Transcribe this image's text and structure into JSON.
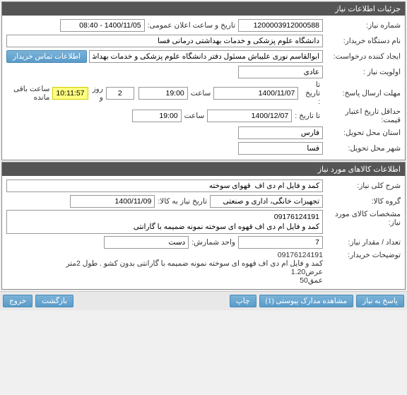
{
  "panel1": {
    "title": "جزئیات اطلاعات نیاز",
    "rows": {
      "need_no_label": "شماره نیاز:",
      "need_no": "1200003912000588",
      "announce_label": "تاریخ و ساعت اعلان عمومی:",
      "announce": "1400/11/05 - 08:40",
      "buyer_label": "نام دستگاه خریدار:",
      "buyer": "دانشگاه علوم پزشکی و خدمات بهداشتی درمانی فسا",
      "creator_label": "ایجاد کننده درخواست:",
      "creator": "ابوالقاسم نوری علیباش مسئول دفتر دانشگاه علوم پزشکی و خدمات بهداشتی د",
      "contact_btn": "اطلاعات تماس خریدار",
      "priority_label": "اولویت نیاز :",
      "priority": "عادی",
      "reply_deadline_label": "مهلت ارسال پاسخ:",
      "to_date1_label": "تا تاریخ :",
      "to_date1": "1400/11/07",
      "time1_label": "ساعت",
      "time1": "19:00",
      "days": "2",
      "days_label": "روز و",
      "remaining_time": "10:11:57",
      "remaining_label": "ساعت باقی مانده",
      "price_validity_label": "حداقل تاریخ اعتبار قیمت:",
      "to_date2_label": "تا تاریخ :",
      "to_date2": "1400/12/07",
      "time2_label": "ساعت",
      "time2": "19:00",
      "province_label": "استان محل تحویل:",
      "province": "فارس",
      "city_label": "شهر محل تحویل:",
      "city": "فسا"
    }
  },
  "panel2": {
    "title": "اطلاعات کالاهای مورد نیاز",
    "rows": {
      "desc_label": "شرح کلی نیاز:",
      "desc": "کمد و فایل ام دی اف  قهوای سوخته",
      "group_label": "گروه کالا:",
      "group": "تجهیزات خانگی، اداری و صنعتی",
      "need_date_label": "تاریخ نیاز به کالا:",
      "need_date": "1400/11/09",
      "spec_label": "مشخصات کالای مورد نیاز:",
      "spec_line1": "09176124191",
      "spec_line2": "کمد و فایل ام دی اف قهوه ای سوخته نمونه ضمیمه با گارانتی",
      "qty_label": "تعداد / مقدار نیاز:",
      "qty": "7",
      "unit_label": "واحد شمارش:",
      "unit": "دست",
      "buyer_notes_label": "توضیحات خریدار:",
      "buyer_notes_l1": "09176124191",
      "buyer_notes_l2": "کمد و فایل ام دی اف قهوه ای سوخته نمونه ضمیمه با گارانتی بدون کشو . طول 2متر",
      "buyer_notes_l3": "عرض1.20",
      "buyer_notes_l4": "عمق50"
    }
  },
  "buttons": {
    "reply": "پاسخ به نیاز",
    "attachments": "مشاهده مدارک پیوستی (1)",
    "print": "چاپ",
    "back": "بازگشت",
    "exit": "خروج"
  }
}
